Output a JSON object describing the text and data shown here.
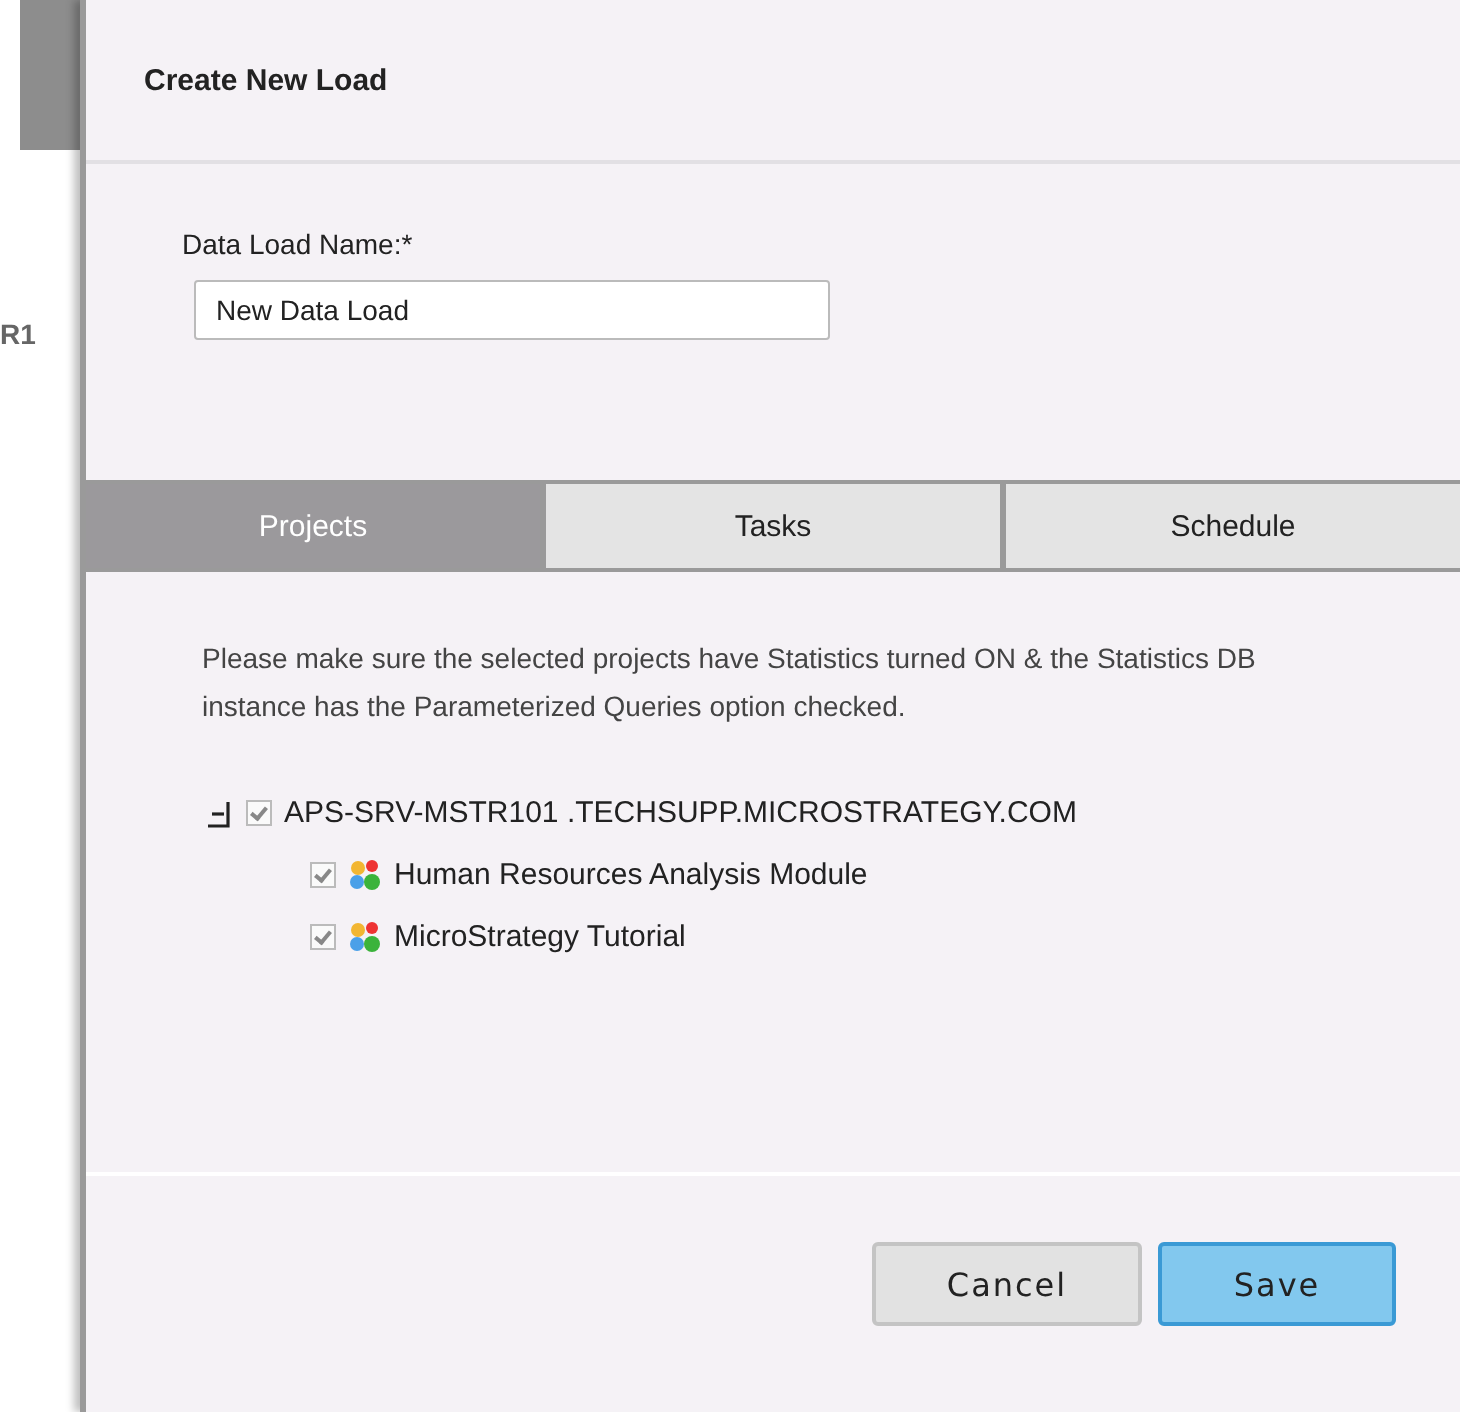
{
  "background": {
    "text": "R1"
  },
  "dialog": {
    "title": "Create New Load",
    "name_label": "Data Load Name:*",
    "name_value": "New Data Load",
    "tabs": [
      {
        "label": "Projects",
        "selected": true
      },
      {
        "label": "Tasks",
        "selected": false
      },
      {
        "label": "Schedule",
        "selected": false
      }
    ],
    "note": "Please make sure the selected projects have Statistics turned ON & the Statistics DB instance has the Parameterized Queries option checked.",
    "tree": [
      {
        "label": "APS-SRV-MSTR101 .TECHSUPP.MICROSTRATEGY.COM",
        "checked": true,
        "expanded": true,
        "children": [
          {
            "label": "Human Resources Analysis Module",
            "checked": true
          },
          {
            "label": "MicroStrategy Tutorial",
            "checked": true
          }
        ]
      }
    ],
    "buttons": [
      {
        "label": "Cancel",
        "kind": "secondary"
      },
      {
        "label": "Save",
        "kind": "primary"
      }
    ]
  }
}
